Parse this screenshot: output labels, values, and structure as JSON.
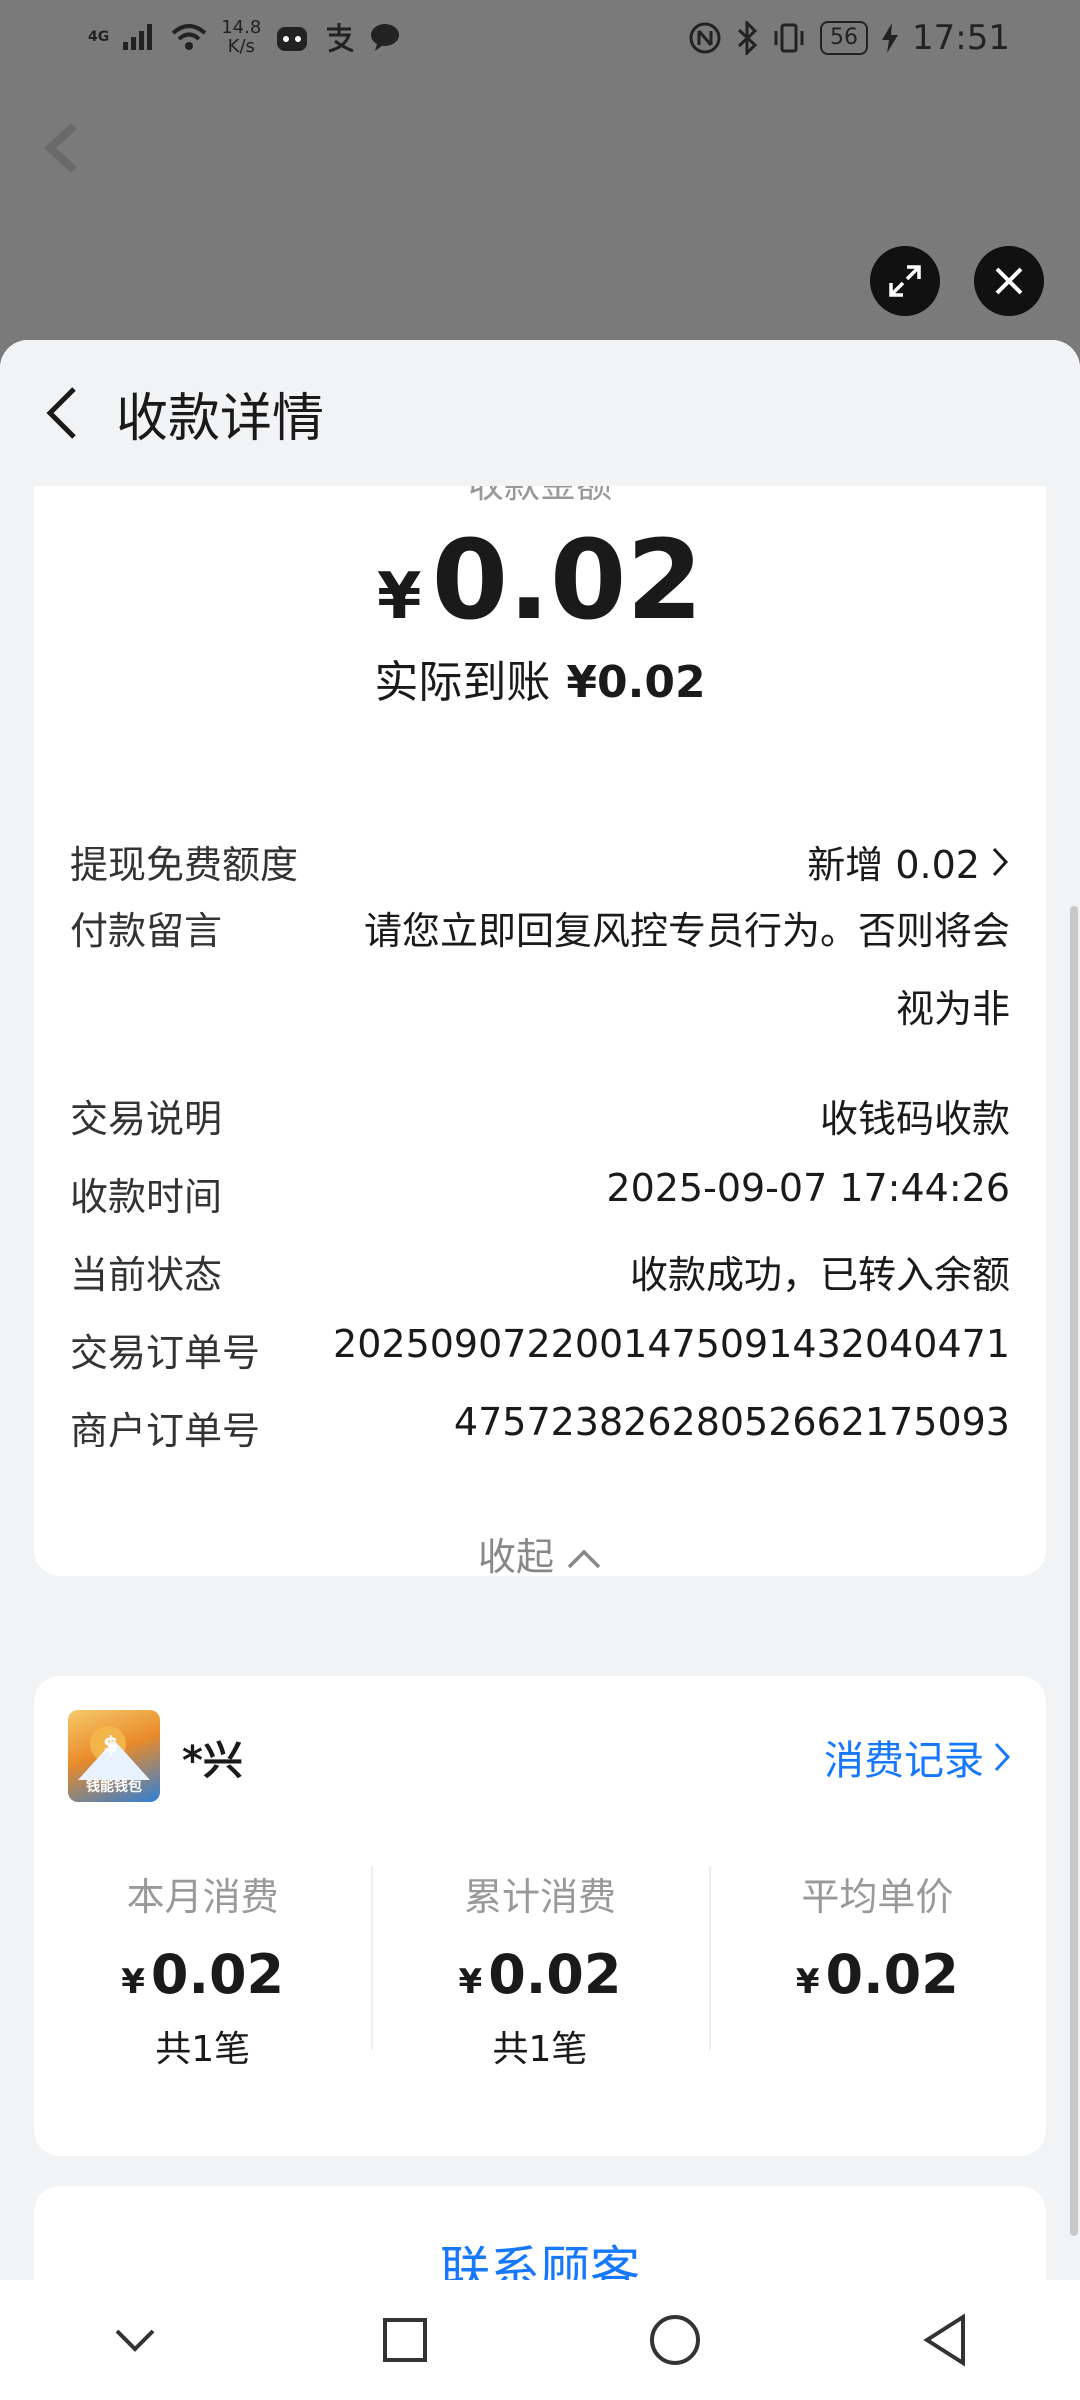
{
  "status_bar": {
    "network": "4G",
    "speed_value": "14.8",
    "speed_unit": "K/s",
    "battery": "56",
    "time": "17:51"
  },
  "header": {
    "title": "收款详情"
  },
  "summary": {
    "amount_label": "收款金额",
    "currency": "¥",
    "amount": "0.02",
    "actual_label": "实际到账",
    "actual_value": "¥0.02"
  },
  "details": [
    {
      "key": "提现免费额度",
      "value": "新增 0.02"
    },
    {
      "key": "付款留言",
      "value": "请您立即回复风控专员行为。否则将会视为非"
    },
    {
      "key": "交易说明",
      "value": "收钱码收款"
    },
    {
      "key": "收款时间",
      "value": "2025-09-07 17:44:26"
    },
    {
      "key": "当前状态",
      "value": "收款成功，已转入余额"
    },
    {
      "key": "交易订单号",
      "value": "2025090722001475091432040471"
    },
    {
      "key": "商户订单号",
      "value": "47572382628052662175093"
    }
  ],
  "collapse_label": "收起",
  "merchant": {
    "logo_text": "钱能钱包",
    "name": "*兴",
    "records_link": "消费记录",
    "stats": [
      {
        "label": "本月消费",
        "value": "0.02",
        "count": "共1笔"
      },
      {
        "label": "累计消费",
        "value": "0.02",
        "count": "共1笔"
      },
      {
        "label": "平均单价",
        "value": "0.02",
        "count": ""
      }
    ]
  },
  "contact_button": "联系顾客",
  "colors": {
    "accent": "#1677ff",
    "sheet_bg": "#f2f3f5",
    "backdrop": "#7a7a7a"
  }
}
